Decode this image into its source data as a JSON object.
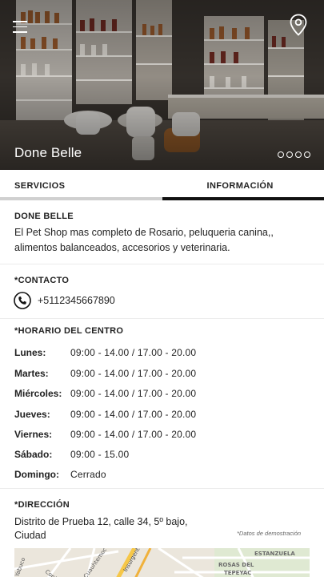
{
  "hero": {
    "title": "Done Belle",
    "menu_icon": "hamburger-menu-icon",
    "location_icon": "map-pin-icon",
    "carousel_dots": 4
  },
  "tabs": [
    {
      "label": "SERVICIOS",
      "active": false
    },
    {
      "label": "INFORMACIÓN",
      "active": true
    }
  ],
  "about": {
    "title": "DONE BELLE",
    "description": "El Pet Shop mas completo de Rosario, peluqueria canina,, alimentos balanceados, accesorios y veterinaria."
  },
  "contact": {
    "title": "*CONTACTO",
    "phone": "+5112345667890",
    "phone_icon": "phone-icon"
  },
  "hours": {
    "title": "*HORARIO DEL CENTRO",
    "rows": [
      {
        "day": "Lunes:",
        "time": "09:00 - 14.00  /  17.00 - 20.00"
      },
      {
        "day": "Martes:",
        "time": "09:00 - 14.00  /  17.00 - 20.00"
      },
      {
        "day": "Miércoles:",
        "time": "09:00 - 14.00  /  17.00 - 20.00"
      },
      {
        "day": "Jueves:",
        "time": "09:00 - 14.00  /  17.00 - 20.00"
      },
      {
        "day": "Viernes:",
        "time": "09:00 - 14.00  /  17.00 - 20.00"
      },
      {
        "day": "Sábado:",
        "time": "09:00 - 15.00"
      },
      {
        "day": "Domingo:",
        "time": "Cerrado"
      }
    ]
  },
  "address": {
    "title": "*DIRECCIÓN",
    "text": "Distrito de Prueba 12, calle 34, 5º bajo, Ciudad",
    "note": "*Datos de demostración"
  },
  "map": {
    "labels": [
      "ESTANZUELA",
      "ROSAS DEL",
      "TEPEYAC",
      "Insurgentes Norte",
      "Cuauhtemoc",
      "Copiadora",
      "Yabuco"
    ]
  },
  "colors": {
    "accent": "#111111",
    "inactive_tab_bar": "#d0d0d0",
    "hero_text": "#ffffff"
  }
}
